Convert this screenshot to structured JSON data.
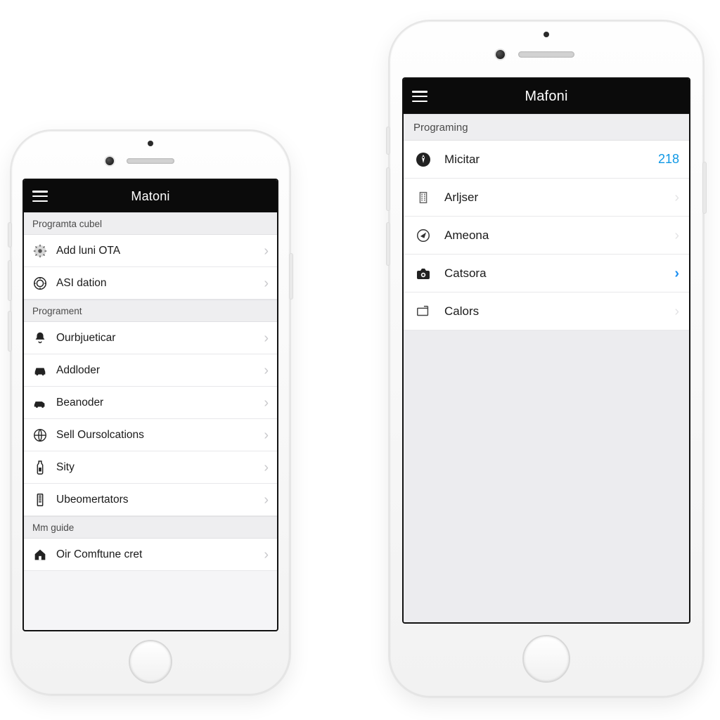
{
  "phoneLeft": {
    "navbar": {
      "title": "Matoni"
    },
    "sections": [
      {
        "header": "Programta cubel",
        "rows": [
          {
            "icon": "gear-icon",
            "label": "Add luni OTA",
            "trailing": "chevron"
          },
          {
            "icon": "badge-icon",
            "label": "ASI dation",
            "trailing": "chevron"
          }
        ]
      },
      {
        "header": "Programent",
        "rows": [
          {
            "icon": "bell-icon",
            "label": "Ourbjueticar",
            "trailing": "chevron"
          },
          {
            "icon": "car-icon",
            "label": "Addloder",
            "trailing": "chevron"
          },
          {
            "icon": "car2-icon",
            "label": "Beanoder",
            "trailing": "chevron"
          },
          {
            "icon": "globe-icon",
            "label": "Sell Oursolcations",
            "trailing": "chevron"
          },
          {
            "icon": "bottle-icon",
            "label": "Sity",
            "trailing": "chevron"
          },
          {
            "icon": "device-icon",
            "label": "Ubeomertators",
            "trailing": "chevron"
          }
        ]
      },
      {
        "header": "Mm guide",
        "rows": [
          {
            "icon": "house-icon",
            "label": "Oir Comftune cret",
            "trailing": "chevron"
          }
        ]
      }
    ]
  },
  "phoneRight": {
    "navbar": {
      "title": "Mafoni"
    },
    "sections": [
      {
        "header": "Programing",
        "rows": [
          {
            "icon": "rocket-icon",
            "label": "Micitar",
            "trailing": "badge",
            "badge": "218"
          },
          {
            "icon": "building-icon",
            "label": "Arljser",
            "trailing": "chevron-dim"
          },
          {
            "icon": "compass-icon",
            "label": "Ameona",
            "trailing": "chevron-dim"
          },
          {
            "icon": "camera-icon",
            "label": "Catsora",
            "trailing": "chevron-blue"
          },
          {
            "icon": "display-icon",
            "label": "Calors",
            "trailing": "chevron-dim"
          }
        ]
      }
    ]
  },
  "colors": {
    "accent": "#1b8ff2",
    "badge": "#0f98e5"
  }
}
